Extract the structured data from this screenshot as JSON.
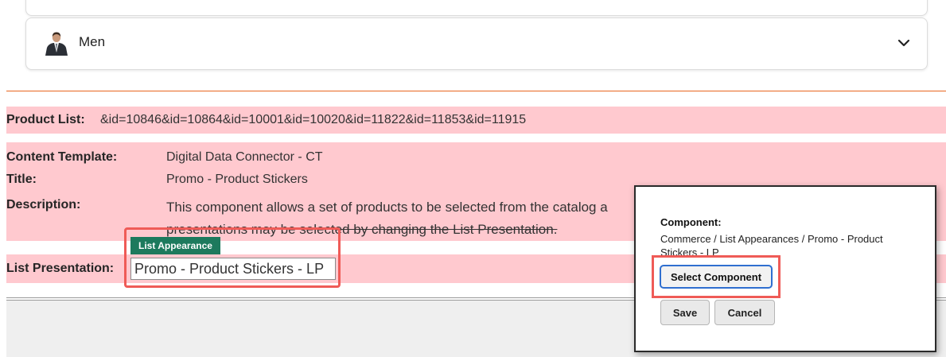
{
  "accordion": {
    "item_label": "Men"
  },
  "product_list": {
    "label": "Product List:",
    "value": "&id=10846&id=10864&id=10001&id=10020&id=11822&id=11853&id=11915"
  },
  "details": {
    "content_template_label": "Content Template:",
    "content_template_value": "Digital Data Connector - CT",
    "title_label": "Title:",
    "title_value": "Promo - Product Stickers",
    "description_label": "Description:",
    "description_line1": "This component allows a set of products to be selected from the catalog a",
    "description_line2": "presentations may be selected by changing the List Presentation."
  },
  "list_presentation": {
    "label": "List Presentation:",
    "tag": "List Appearance",
    "value": "Promo - Product Stickers - LP"
  },
  "dialog": {
    "title": "Component:",
    "path": "Commerce / List Appearances / Promo - Product Stickers - LP",
    "select_label": "Select Component",
    "save_label": "Save",
    "cancel_label": "Cancel"
  },
  "colors": {
    "pink_band": "#ffc9cf",
    "highlight": "#ef5b57",
    "tag_green": "#1d7a5d",
    "divider_orange": "#e9661f"
  }
}
